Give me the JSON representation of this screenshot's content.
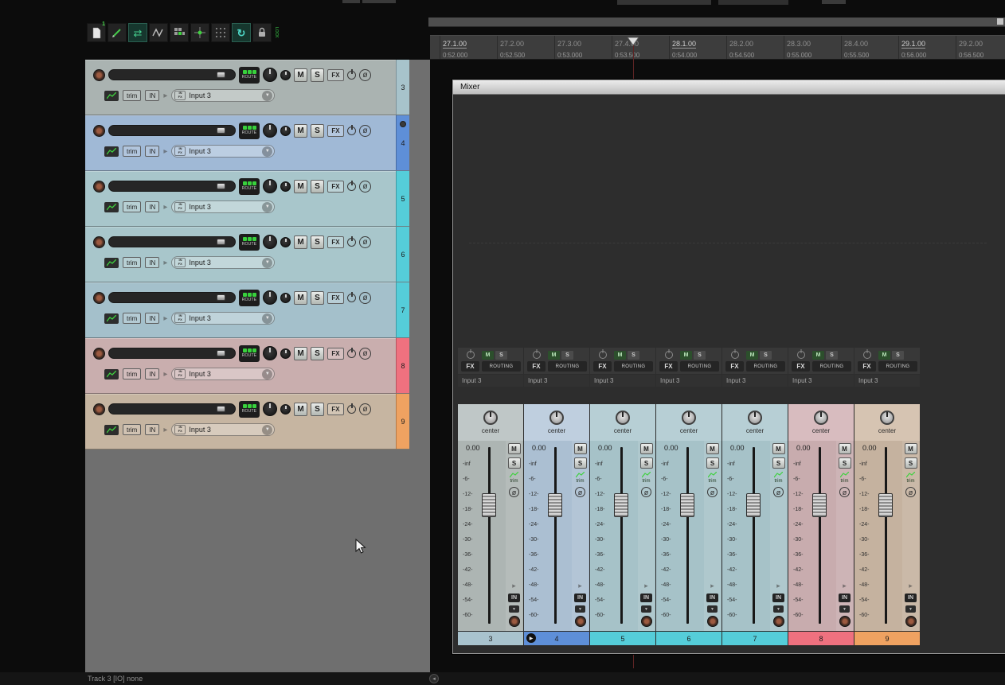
{
  "window": {
    "status_bar": "Track 3 [IO] none"
  },
  "toolbar": {
    "file_badge": "1",
    "lock_label": "LOCK"
  },
  "labels": {
    "mute": "M",
    "solo": "S",
    "fx": "FX",
    "route": "ROUTE",
    "routing": "ROUTING",
    "trim": "trim",
    "in": "IN",
    "input": "Input 3",
    "pan": "center",
    "volume": "0.00"
  },
  "icons": {
    "phase": "ø",
    "dropdown": "▼",
    "fold": "▸",
    "play": "▶",
    "scroll_left": "◂",
    "move": "⇄",
    "loop": "↻"
  },
  "ruler": {
    "marks": [
      {
        "beat": "27.1.00",
        "time": "0:52.000",
        "major": true,
        "beat_color": "#cfcfcf",
        "beat_border": "1px solid #9a9a9a"
      },
      {
        "beat": "27.2.00",
        "time": "0:52.500",
        "major": false,
        "beat_color": "#8f8f8f",
        "beat_border": "none"
      },
      {
        "beat": "27.3.00",
        "time": "0:53.000",
        "major": false,
        "beat_color": "#8f8f8f",
        "beat_border": "none"
      },
      {
        "beat": "27.4.00",
        "time": "0:53.500",
        "major": false,
        "beat_color": "#8f8f8f",
        "beat_border": "none"
      },
      {
        "beat": "28.1.00",
        "time": "0:54.000",
        "major": true,
        "beat_color": "#cfcfcf",
        "beat_border": "1px solid #9a9a9a"
      },
      {
        "beat": "28.2.00",
        "time": "0:54.500",
        "major": false,
        "beat_color": "#8f8f8f",
        "beat_border": "none"
      },
      {
        "beat": "28.3.00",
        "time": "0:55.000",
        "major": false,
        "beat_color": "#8f8f8f",
        "beat_border": "none"
      },
      {
        "beat": "28.4.00",
        "time": "0:55.500",
        "major": false,
        "beat_color": "#8f8f8f",
        "beat_border": "none"
      },
      {
        "beat": "29.1.00",
        "time": "0:56.000",
        "major": true,
        "beat_color": "#cfcfcf",
        "beat_border": "1px solid #9a9a9a"
      },
      {
        "beat": "29.2.00",
        "time": "0:56.500",
        "major": false,
        "beat_color": "#8f8f8f",
        "beat_border": "none"
      }
    ]
  },
  "tracks": [
    {
      "number": "3",
      "colors": {
        "bg": "#aab3b1",
        "tab": "#a7c3cb"
      }
    },
    {
      "number": "4",
      "marker": true,
      "colors": {
        "bg": "#a0b9d6",
        "tab": "#5e8fd8"
      }
    },
    {
      "number": "5",
      "colors": {
        "bg": "#a8c6cb",
        "tab": "#55cdd9"
      }
    },
    {
      "number": "6",
      "colors": {
        "bg": "#a8c6cb",
        "tab": "#55cdd9"
      }
    },
    {
      "number": "7",
      "colors": {
        "bg": "#a4c0cb",
        "tab": "#55cdd9"
      }
    },
    {
      "number": "8",
      "colors": {
        "bg": "#c9aeae",
        "tab": "#ef717f"
      }
    },
    {
      "number": "9",
      "colors": {
        "bg": "#c6b5a1",
        "tab": "#efa261"
      }
    }
  ],
  "mixer": {
    "title": "Mixer",
    "db_scale": [
      "-inf",
      "-6-",
      "-12-",
      "-18-",
      "-24-",
      "-30-",
      "-36-",
      "-42-",
      "-48-",
      "-54-",
      "-60-"
    ],
    "channels": [
      {
        "number": "3",
        "playing": false,
        "colors": {
          "pan": "#bfc7c7",
          "fader": "#adb5b3",
          "strip": "#a9c3ce"
        }
      },
      {
        "number": "4",
        "playing": true,
        "colors": {
          "pan": "#bfcfdf",
          "fader": "#abbfd2",
          "strip": "#5e8fd8"
        }
      },
      {
        "number": "5",
        "playing": false,
        "colors": {
          "pan": "#b7cfd5",
          "fader": "#a6c2c8",
          "strip": "#55cdd9"
        }
      },
      {
        "number": "6",
        "playing": false,
        "colors": {
          "pan": "#b7cfd5",
          "fader": "#a6c2c8",
          "strip": "#55cdd9"
        }
      },
      {
        "number": "7",
        "playing": false,
        "colors": {
          "pan": "#b7cfd5",
          "fader": "#a6c2c8",
          "strip": "#55cdd9"
        }
      },
      {
        "number": "8",
        "playing": false,
        "colors": {
          "pan": "#d8bcbf",
          "fader": "#c8acae",
          "strip": "#ef717f"
        }
      },
      {
        "number": "9",
        "playing": false,
        "colors": {
          "pan": "#d6c4b2",
          "fader": "#c5b29f",
          "strip": "#efa261"
        }
      }
    ]
  }
}
